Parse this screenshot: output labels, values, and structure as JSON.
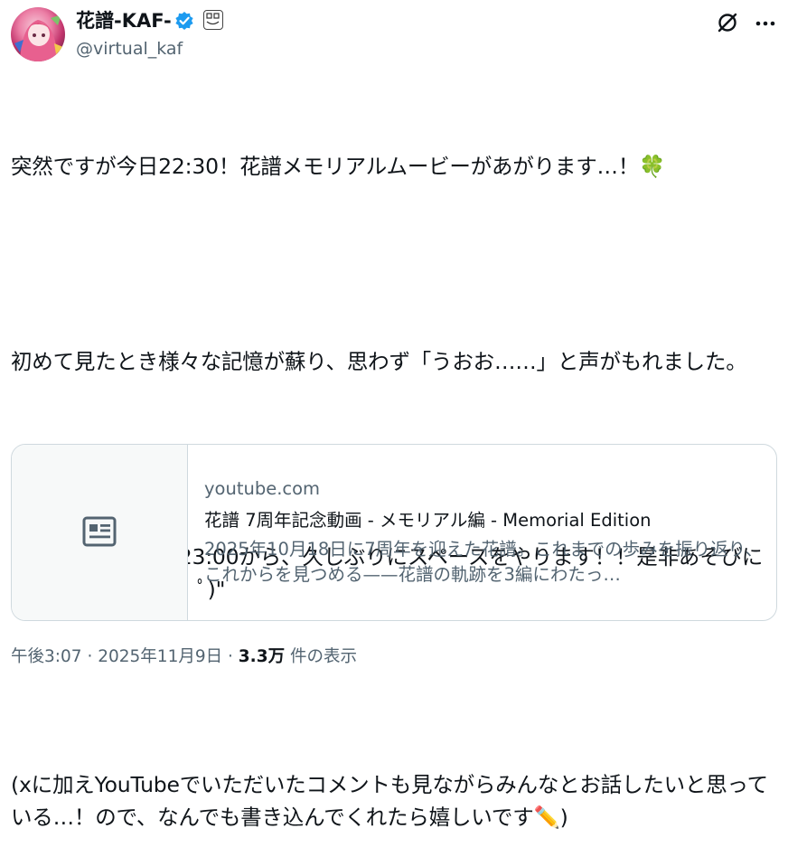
{
  "author": {
    "display_name": "花譜-KAF-",
    "username": "@virtual_kaf",
    "verified": true,
    "accent_color": "#1d9bf0"
  },
  "header": {
    "grok_icon": "grok-icon",
    "more_icon": "more-icon"
  },
  "tweet": {
    "paragraphs": [
      "突然ですが今日22:30！花譜メモリアルムービーがあがります…！🍀",
      "初めて見たとき様々な記憶が蘇り、思わず「うおお……」と声がもれました。",
      "そして動画投稿後23:00から、久しぶりにスペースをやります！！是非あそびにお越しください(ﾟ．ﾟ)\"",
      "(xに加えYouTubeでいただいたコメントも見ながらみんなとお話したいと思っている…！ので、なんでも書き込んでくれたら嬉しいです✏️)"
    ]
  },
  "card": {
    "icon": "article-icon",
    "domain": "youtube.com",
    "title": "花譜 7周年記念動画 - メモリアル編 - Memorial Edition",
    "description": "2025年10月18日に7周年を迎えた花譜。これまでの歩みを振り返り、これからを見つめる——花譜の軌跡を3編にわたって"
  },
  "meta": {
    "time": "午後3:07",
    "separator": "·",
    "date": "2025年11月9日",
    "views_count": "3.3万",
    "views_label": "件の表示"
  }
}
